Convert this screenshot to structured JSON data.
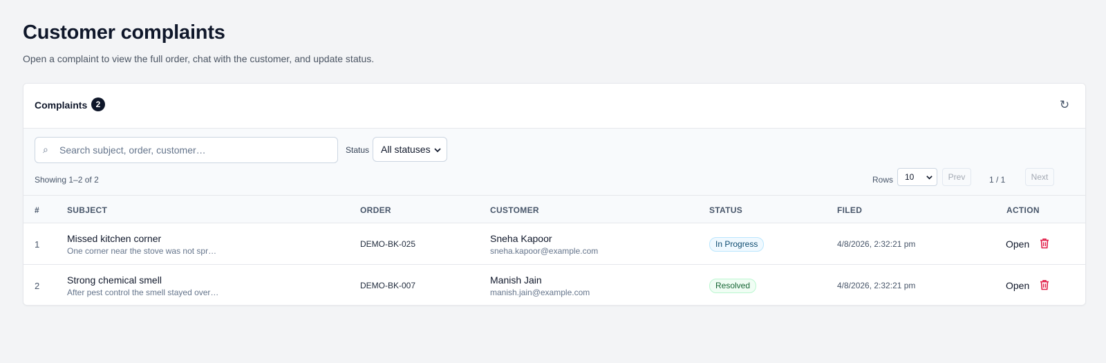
{
  "page": {
    "title": "Customer complaints",
    "subtitle": "Open a complaint to view the full order, chat with the customer, and update status."
  },
  "card": {
    "title": "Complaints",
    "count": "2",
    "refresh_icon": "↻"
  },
  "toolbar": {
    "search_icon": "⌕",
    "search_placeholder": "Search subject, order, customer…",
    "search_value": "",
    "status_label": "Status",
    "status_selected": "All statuses",
    "showing": "Showing 1–2 of 2",
    "rows_label": "Rows",
    "rows_selected": "10",
    "prev_label": "Prev",
    "page_indicator": "1 / 1",
    "next_label": "Next"
  },
  "table": {
    "headers": {
      "num": "#",
      "subject": "SUBJECT",
      "order": "ORDER",
      "customer": "CUSTOMER",
      "status": "STATUS",
      "filed": "FILED",
      "action": "ACTION"
    },
    "rows": [
      {
        "num": "1",
        "subject": "Missed kitchen corner",
        "subject_preview": "One corner near the stove was not spr…",
        "order": "DEMO-BK-025",
        "customer": "Sneha Kapoor",
        "email": "sneha.kapoor@example.com",
        "status": "In Progress",
        "filed": "4/8/2026, 2:32:21 pm",
        "action": "Open"
      },
      {
        "num": "2",
        "subject": "Strong chemical smell",
        "subject_preview": "After pest control the smell stayed over…",
        "order": "DEMO-BK-007",
        "customer": "Manish Jain",
        "email": "manish.jain@example.com",
        "status": "Resolved",
        "filed": "4/8/2026, 2:32:21 pm",
        "action": "Open"
      }
    ]
  },
  "colors": {
    "in_progress": "#0c4a6e",
    "resolved": "#166534",
    "delete": "#e11d48",
    "badge_count_bg": "#0f172a"
  },
  "icons": {
    "refresh": "refresh-icon",
    "search": "search-icon",
    "delete": "trash-icon",
    "dropdown": "chevron-down-icon"
  }
}
